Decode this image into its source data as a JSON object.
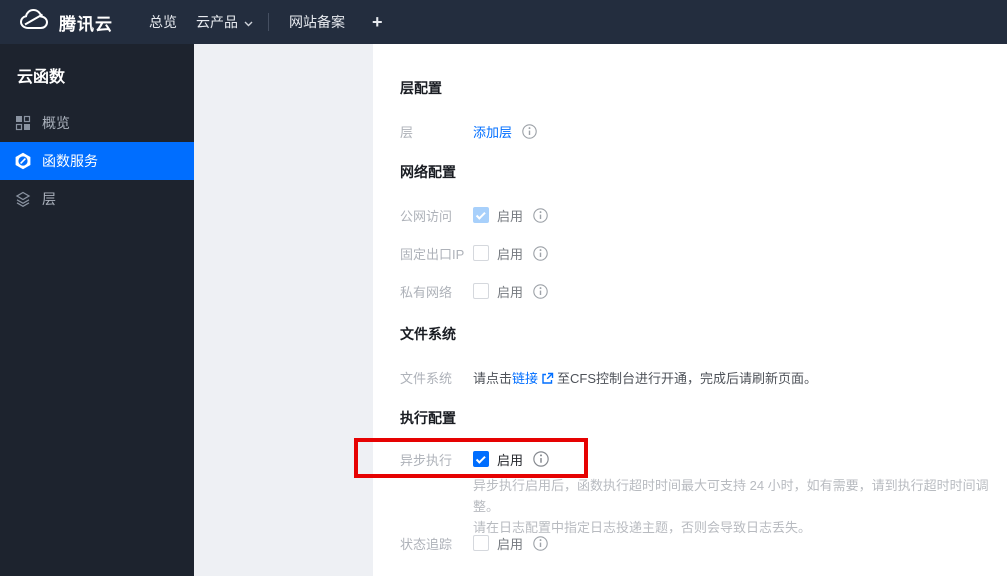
{
  "navbar": {
    "brand": "腾讯云",
    "nav_overview": "总览",
    "nav_products": "云产品",
    "nav_icp": "网站备案",
    "nav_add": "+"
  },
  "sidebar": {
    "title": "云函数",
    "item_overview": "概览",
    "item_function_service": "函数服务",
    "item_layers": "层"
  },
  "content": {
    "layer_section": {
      "title": "层配置",
      "row_label": "层",
      "add_layer_link": "添加层"
    },
    "network_section": {
      "title": "网络配置",
      "public_access": {
        "label": "公网访问",
        "enable": "启用",
        "state": "checked-disabled"
      },
      "fixed_ip": {
        "label": "固定出口IP",
        "enable": "启用",
        "state": "unchecked"
      },
      "private_network": {
        "label": "私有网络",
        "enable": "启用",
        "state": "unchecked"
      }
    },
    "filesystem_section": {
      "title": "文件系统",
      "row_label": "文件系统",
      "text_before": "请点击",
      "link": "链接",
      "text_after": "至CFS控制台进行开通，完成后请刷新页面。"
    },
    "execution_section": {
      "title": "执行配置",
      "async_execution": {
        "label": "异步执行",
        "enable": "启用",
        "state": "checked"
      },
      "async_note_line1": "异步执行启用后，函数执行超时时间最大可支持 24 小时，如有需要，请到执行超时时间调整。",
      "async_note_line2": "请在日志配置中指定日志投递主题，否则会导致日志丢失。",
      "status_tracking": {
        "label": "状态追踪",
        "enable": "启用",
        "state": "unchecked"
      }
    }
  },
  "annotation": {
    "highlight_color": "#e60202"
  },
  "colors": {
    "accent": "#006eff",
    "navbar_bg": "#232d3e",
    "sidebar_bg": "#1d232e",
    "page_bg": "#eef0f4",
    "checkbox_disabled_checked": "#a8d0fb"
  }
}
